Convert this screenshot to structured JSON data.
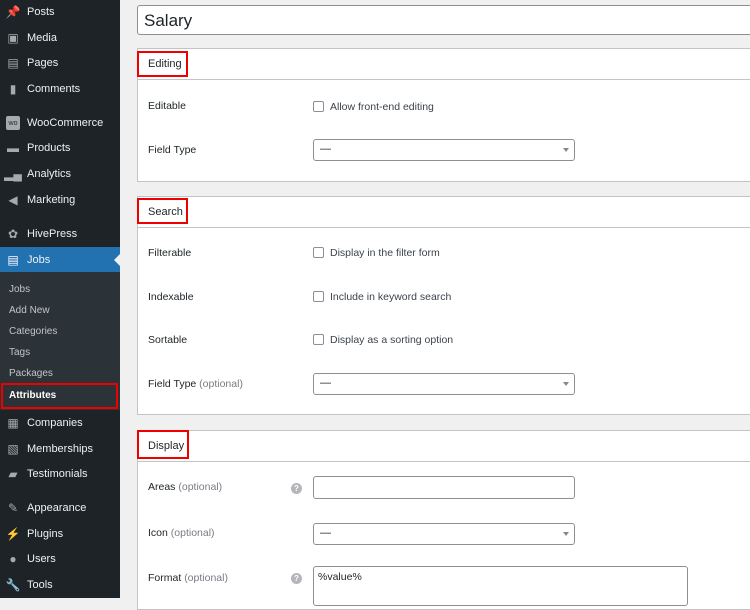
{
  "sidebar": {
    "items": [
      {
        "label": "Posts",
        "icon": "pin-icon"
      },
      {
        "label": "Media",
        "icon": "media-icon"
      },
      {
        "label": "Pages",
        "icon": "pages-icon"
      },
      {
        "label": "Comments",
        "icon": "comment-icon"
      },
      {
        "label": "WooCommerce",
        "icon": "woocommerce-icon"
      },
      {
        "label": "Products",
        "icon": "archive-icon"
      },
      {
        "label": "Analytics",
        "icon": "bar-chart-icon"
      },
      {
        "label": "Marketing",
        "icon": "megaphone-icon"
      },
      {
        "label": "HivePress",
        "icon": "hivepress-icon"
      },
      {
        "label": "Jobs",
        "icon": "document-icon"
      },
      {
        "label": "Companies",
        "icon": "building-icon"
      },
      {
        "label": "Memberships",
        "icon": "id-card-icon"
      },
      {
        "label": "Testimonials",
        "icon": "quote-icon"
      },
      {
        "label": "Appearance",
        "icon": "brush-icon"
      },
      {
        "label": "Plugins",
        "icon": "plug-icon"
      },
      {
        "label": "Users",
        "icon": "user-icon"
      },
      {
        "label": "Tools",
        "icon": "wrench-icon"
      }
    ],
    "submenu": [
      "Jobs",
      "Add New",
      "Categories",
      "Tags",
      "Packages",
      "Attributes"
    ],
    "active": "Jobs",
    "active_sub": "Attributes"
  },
  "title_value": "Salary",
  "editing": {
    "heading": "Editing",
    "editable_label": "Editable",
    "editable_checkbox": "Allow front-end editing",
    "field_type_label": "Field Type",
    "field_type_value": "—"
  },
  "search": {
    "heading": "Search",
    "filterable_label": "Filterable",
    "filterable_checkbox": "Display in the filter form",
    "indexable_label": "Indexable",
    "indexable_checkbox": "Include in keyword search",
    "sortable_label": "Sortable",
    "sortable_checkbox": "Display as a sorting option",
    "field_type_label": "Field Type",
    "optional": "(optional)",
    "field_type_value": "—"
  },
  "display": {
    "heading": "Display",
    "areas_label": "Areas",
    "icon_label": "Icon",
    "format_label": "Format",
    "optional": "(optional)",
    "icon_value": "—",
    "format_value": "%value%"
  },
  "colors": {
    "sidebar": "#1d2327",
    "active": "#2271b1",
    "highlight": "#ee0000"
  }
}
